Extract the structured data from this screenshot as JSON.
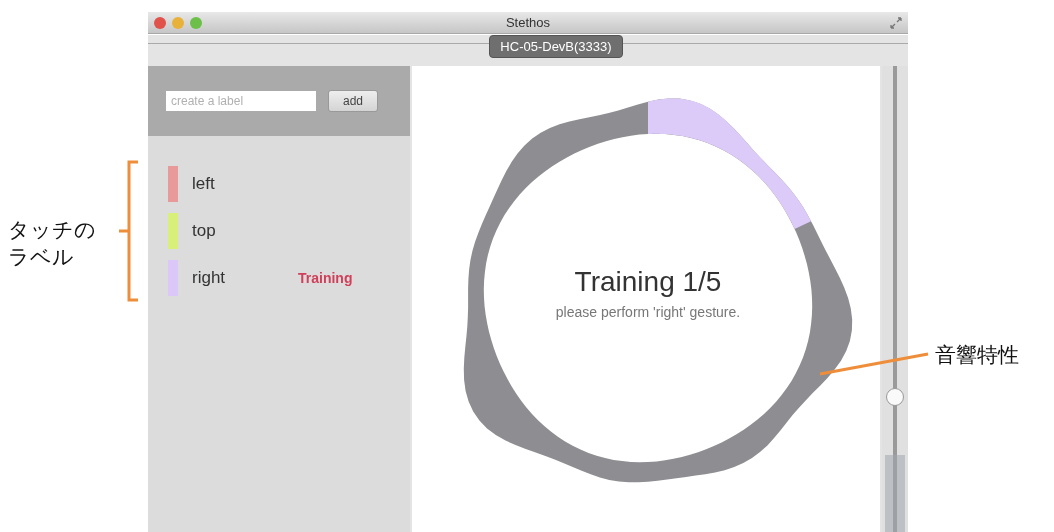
{
  "window": {
    "title": "Stethos"
  },
  "device_tab": {
    "label": "HC-05-DevB(3333)"
  },
  "sidebar": {
    "label_field": {
      "placeholder": "create a label"
    },
    "add_button": "add",
    "labels": [
      {
        "name": "left",
        "color": "#e89a9a"
      },
      {
        "name": "top",
        "color": "#d8f07a"
      },
      {
        "name": "right",
        "color": "#dcc8f8",
        "status": "Training"
      }
    ]
  },
  "training": {
    "title": "Training 1/5",
    "instruction": "please perform 'right' gesture."
  },
  "slider": {
    "level": 0.29
  },
  "annotations": {
    "labels_note": "タッチのラベル",
    "ring_note": "音響特性"
  }
}
